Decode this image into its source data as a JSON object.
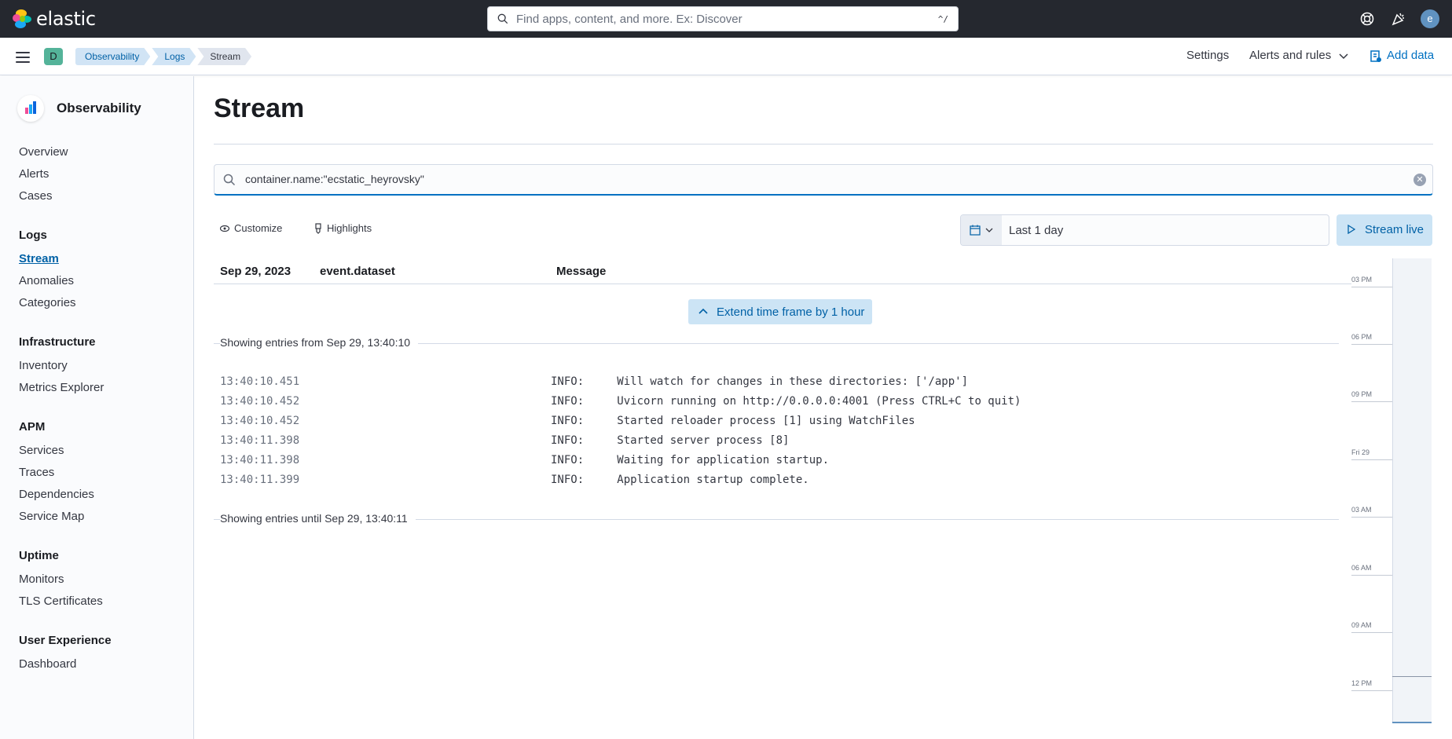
{
  "header": {
    "brand": "elastic",
    "search_placeholder": "Find apps, content, and more. Ex: Discover",
    "search_shortcut": "^/",
    "avatar_initial": "e"
  },
  "subbar": {
    "space_initial": "D",
    "breadcrumbs": [
      "Observability",
      "Logs",
      "Stream"
    ],
    "settings": "Settings",
    "alerts_rules": "Alerts and rules",
    "add_data": "Add data"
  },
  "sidebar": {
    "app_name": "Observability",
    "items": {
      "overview": "Overview",
      "alerts": "Alerts",
      "cases": "Cases",
      "logs_group": "Logs",
      "stream": "Stream",
      "anomalies": "Anomalies",
      "categories": "Categories",
      "infra_group": "Infrastructure",
      "inventory": "Inventory",
      "metrics_explorer": "Metrics Explorer",
      "apm_group": "APM",
      "services": "Services",
      "traces": "Traces",
      "dependencies": "Dependencies",
      "service_map": "Service Map",
      "uptime_group": "Uptime",
      "monitors": "Monitors",
      "tls": "TLS Certificates",
      "ux_group": "User Experience",
      "dashboard": "Dashboard"
    }
  },
  "main": {
    "title": "Stream",
    "query": "container.name:\"ecstatic_heyrovsky\"",
    "customize": "Customize",
    "highlights": "Highlights",
    "date_range": "Last 1 day",
    "stream_live": "Stream live",
    "columns": {
      "date": "Sep 29, 2023",
      "dataset": "event.dataset",
      "message": "Message"
    },
    "extend_button": "Extend time frame by 1 hour",
    "showing_from": "Showing entries from Sep 29, 13:40:10",
    "showing_until": "Showing entries until Sep 29, 13:40:11",
    "rows": [
      {
        "ts": "13:40:10.451",
        "msg": "INFO:     Will watch for changes in these directories: ['/app']"
      },
      {
        "ts": "13:40:10.452",
        "msg": "INFO:     Uvicorn running on http://0.0.0.0:4001 (Press CTRL+C to quit)"
      },
      {
        "ts": "13:40:10.452",
        "msg": "INFO:     Started reloader process [1] using WatchFiles"
      },
      {
        "ts": "13:40:11.398",
        "msg": "INFO:     Started server process [8]"
      },
      {
        "ts": "13:40:11.398",
        "msg": "INFO:     Waiting for application startup."
      },
      {
        "ts": "13:40:11.399",
        "msg": "INFO:     Application startup complete."
      }
    ],
    "minimap_ticks": [
      "03 PM",
      "06 PM",
      "09 PM",
      "Fri 29",
      "03 AM",
      "06 AM",
      "09 AM",
      "12 PM"
    ]
  },
  "colors": {
    "header_bg": "#25282f",
    "link": "#0061a6",
    "accent_bg": "#cce4f5"
  }
}
